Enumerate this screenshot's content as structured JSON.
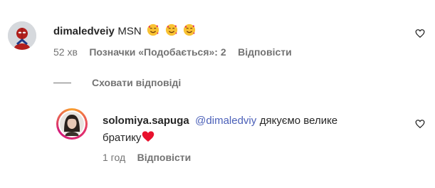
{
  "comments": [
    {
      "username": "dimaledveiy",
      "text": "MSN",
      "emojis": [
        "smiling-face-with-hearts",
        "smiling-face-with-hearts",
        "smiling-face-with-hearts"
      ],
      "time": "52 хв",
      "likes_label": "Позначки «Подобається»: 2",
      "reply_label": "Відповісти"
    }
  ],
  "hide_replies_label": "Сховати відповіді",
  "replies": [
    {
      "username": "solomiya.sapuga",
      "mention": "@dimaledviy",
      "text_line1": "дякуємо велике",
      "text_line2": "братику",
      "emoji": "red-heart",
      "time": "1 год",
      "reply_label": "Відповісти"
    }
  ],
  "colors": {
    "meta": "#737373",
    "mention": "#4a5fb8",
    "text": "#262626",
    "story_ring_from": "#f9a12e",
    "story_ring_to": "#d41c7b"
  }
}
